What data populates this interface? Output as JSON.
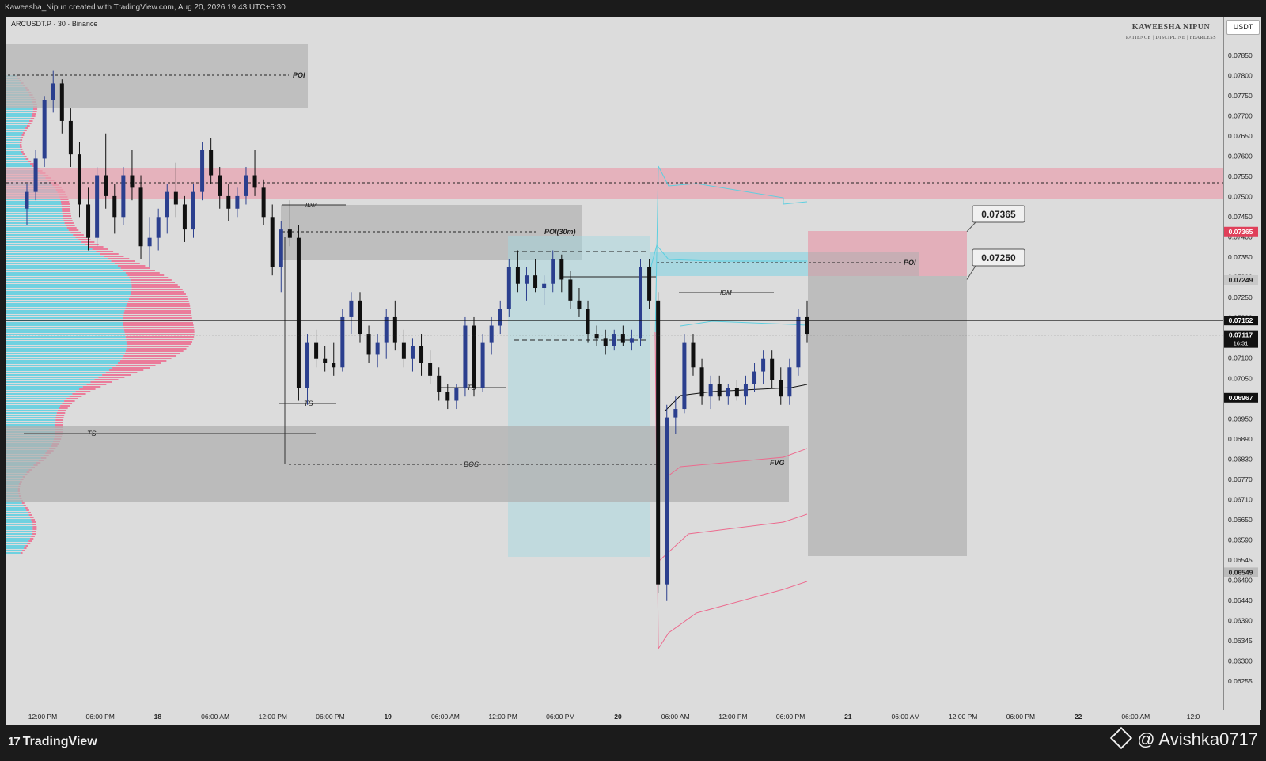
{
  "header": {
    "attribution": "Kaweesha_Nipun created with TradingView.com, Aug 20, 2026 19:43 UTC+5:30",
    "symbol": "ARCUSDT.P · 30 · Binance",
    "brand_name": "KAWEESHA NIPUN",
    "brand_tagline": "PATIENCE | DISCIPLINE | FEARLESS",
    "currency": "USDT"
  },
  "footer": {
    "logo": "TradingView",
    "watermark": "@ Avishka0717"
  },
  "colors": {
    "background": "#dcdcdc",
    "bull": "#2b3f8e",
    "bear": "#101010",
    "supply_zone": "#e8a4b2",
    "profile_blue": "#5ccfe0",
    "profile_pink": "#ec6b8e",
    "premium_zone": "#9fd6e0"
  },
  "annotations": {
    "poi_top": "POI",
    "idm_top": "IDM",
    "poi_30m": "POI(30m)",
    "ts_1": "TS",
    "ts_2": "TS",
    "ts_3": "TS",
    "bos": "BOS",
    "fvg": "FVG",
    "idm_right": "IDM",
    "poi_right": "POI",
    "target_high": "0.07365",
    "target_low": "0.07250"
  },
  "chart_data": {
    "type": "candlestick",
    "y_ticks": [
      "0.07850",
      "0.07800",
      "0.07750",
      "0.07700",
      "0.07650",
      "0.07600",
      "0.07550",
      "0.07500",
      "0.07450",
      "0.07400",
      "0.07350",
      "0.07300",
      "0.07250",
      "0.07200",
      "0.07150",
      "0.07100",
      "0.07050",
      "0.07000",
      "0.06950",
      "0.06890",
      "0.06830",
      "0.06770",
      "0.06710",
      "0.06650",
      "0.06590",
      "0.06545",
      "0.06490",
      "0.06440",
      "0.06390",
      "0.06345",
      "0.06300",
      "0.06255"
    ],
    "x_ticks": [
      "12:00 PM",
      "06:00 PM",
      "18",
      "06:00 AM",
      "12:00 PM",
      "06:00 PM",
      "19",
      "06:00 AM",
      "12:00 PM",
      "06:00 PM",
      "20",
      "06:00 AM",
      "12:00 PM",
      "06:00 PM",
      "21",
      "06:00 AM",
      "12:00 PM",
      "06:00 PM",
      "22",
      "06:00 AM",
      "12:0"
    ],
    "price_labels": [
      {
        "text": "0.07365",
        "value": 0.07365,
        "bg": "#e0405a",
        "color": "#ffffff"
      },
      {
        "text": "0.07249",
        "value": 0.07249,
        "bg": "#c8c8c8",
        "color": "#222222"
      },
      {
        "text": "0.07152",
        "value": 0.07152,
        "bg": "#111111",
        "color": "#ffffff"
      },
      {
        "text": "0.07117",
        "sub": "16:31",
        "value": 0.07117,
        "bg": "#111111",
        "color": "#ffffff"
      },
      {
        "text": "0.06967",
        "value": 0.06967,
        "bg": "#111111",
        "color": "#ffffff"
      },
      {
        "text": "0.06549",
        "value": 0.06549,
        "bg": "#bbbbbb",
        "color": "#222222"
      }
    ],
    "candles": [
      [
        0.0742,
        0.0748,
        0.0738,
        0.0746
      ],
      [
        0.0746,
        0.0756,
        0.0744,
        0.0754
      ],
      [
        0.0754,
        0.0769,
        0.0752,
        0.0768
      ],
      [
        0.0768,
        0.0775,
        0.0765,
        0.0772
      ],
      [
        0.0772,
        0.0773,
        0.076,
        0.0763
      ],
      [
        0.0763,
        0.0766,
        0.0752,
        0.0755
      ],
      [
        0.0755,
        0.0758,
        0.074,
        0.0743
      ],
      [
        0.0743,
        0.0747,
        0.0732,
        0.0735
      ],
      [
        0.0735,
        0.0752,
        0.0733,
        0.075
      ],
      [
        0.075,
        0.076,
        0.0742,
        0.0745
      ],
      [
        0.0745,
        0.0748,
        0.0736,
        0.074
      ],
      [
        0.074,
        0.0752,
        0.0738,
        0.075
      ],
      [
        0.075,
        0.0756,
        0.0744,
        0.0747
      ],
      [
        0.0747,
        0.075,
        0.073,
        0.0733
      ],
      [
        0.0733,
        0.074,
        0.0728,
        0.0735
      ],
      [
        0.0735,
        0.0742,
        0.0732,
        0.074
      ],
      [
        0.074,
        0.0748,
        0.0736,
        0.0746
      ],
      [
        0.0746,
        0.0753,
        0.074,
        0.0743
      ],
      [
        0.0743,
        0.0745,
        0.0734,
        0.0737
      ],
      [
        0.0737,
        0.0748,
        0.0735,
        0.0746
      ],
      [
        0.0746,
        0.0758,
        0.0744,
        0.0756
      ],
      [
        0.0756,
        0.0759,
        0.0748,
        0.075
      ],
      [
        0.075,
        0.0752,
        0.0742,
        0.0745
      ],
      [
        0.0745,
        0.0748,
        0.0739,
        0.0742
      ],
      [
        0.0742,
        0.0747,
        0.074,
        0.0745
      ],
      [
        0.0745,
        0.0752,
        0.0743,
        0.075
      ],
      [
        0.075,
        0.0756,
        0.0745,
        0.0747
      ],
      [
        0.0747,
        0.0749,
        0.0738,
        0.074
      ],
      [
        0.074,
        0.0743,
        0.0726,
        0.0728
      ],
      [
        0.0728,
        0.0739,
        0.0722,
        0.0737
      ],
      [
        0.0737,
        0.0744,
        0.0733,
        0.0735
      ],
      [
        0.0735,
        0.0738,
        0.0696,
        0.0699
      ],
      [
        0.0699,
        0.0712,
        0.0695,
        0.071
      ],
      [
        0.071,
        0.0713,
        0.0704,
        0.0706
      ],
      [
        0.0706,
        0.0709,
        0.0703,
        0.0705
      ],
      [
        0.0705,
        0.071,
        0.0702,
        0.0704
      ],
      [
        0.0704,
        0.0718,
        0.0703,
        0.0716
      ],
      [
        0.0716,
        0.0722,
        0.0712,
        0.072
      ],
      [
        0.072,
        0.0722,
        0.071,
        0.0712
      ],
      [
        0.0712,
        0.0714,
        0.0705,
        0.0707
      ],
      [
        0.0707,
        0.0712,
        0.0704,
        0.071
      ],
      [
        0.071,
        0.0718,
        0.0706,
        0.0716
      ],
      [
        0.0716,
        0.072,
        0.0708,
        0.071
      ],
      [
        0.071,
        0.0713,
        0.0704,
        0.0706
      ],
      [
        0.0706,
        0.0711,
        0.0703,
        0.0709
      ],
      [
        0.0709,
        0.0712,
        0.0702,
        0.0705
      ],
      [
        0.0705,
        0.0708,
        0.07,
        0.0702
      ],
      [
        0.0702,
        0.0704,
        0.0696,
        0.0698
      ],
      [
        0.0698,
        0.07,
        0.0694,
        0.0696
      ],
      [
        0.0696,
        0.07,
        0.0694,
        0.0699
      ],
      [
        0.0699,
        0.0716,
        0.0697,
        0.0714
      ],
      [
        0.0714,
        0.0716,
        0.0697,
        0.0699
      ],
      [
        0.0699,
        0.0712,
        0.0698,
        0.071
      ],
      [
        0.071,
        0.0716,
        0.0707,
        0.0714
      ],
      [
        0.0714,
        0.072,
        0.0712,
        0.0718
      ],
      [
        0.0718,
        0.073,
        0.0716,
        0.0728
      ],
      [
        0.0728,
        0.0732,
        0.0722,
        0.0724
      ],
      [
        0.0724,
        0.0728,
        0.072,
        0.0726
      ],
      [
        0.0726,
        0.073,
        0.0722,
        0.0723
      ],
      [
        0.0723,
        0.0726,
        0.0719,
        0.0724
      ],
      [
        0.0724,
        0.0732,
        0.0722,
        0.073
      ],
      [
        0.073,
        0.0731,
        0.0722,
        0.0725
      ],
      [
        0.0725,
        0.0727,
        0.0718,
        0.072
      ],
      [
        0.072,
        0.0723,
        0.0716,
        0.0718
      ],
      [
        0.0718,
        0.072,
        0.071,
        0.0712
      ],
      [
        0.0712,
        0.0714,
        0.0709,
        0.0711
      ],
      [
        0.0711,
        0.0713,
        0.0707,
        0.0709
      ],
      [
        0.0709,
        0.0713,
        0.0708,
        0.0712
      ],
      [
        0.0712,
        0.0714,
        0.0709,
        0.071
      ],
      [
        0.071,
        0.0713,
        0.0708,
        0.0711
      ],
      [
        0.0711,
        0.073,
        0.0709,
        0.0728
      ],
      [
        0.0728,
        0.073,
        0.0718,
        0.072
      ],
      [
        0.072,
        0.0722,
        0.065,
        0.0652
      ],
      [
        0.0652,
        0.0695,
        0.0648,
        0.0692
      ],
      [
        0.0692,
        0.0697,
        0.0688,
        0.0694
      ],
      [
        0.0694,
        0.0712,
        0.0693,
        0.071
      ],
      [
        0.071,
        0.0712,
        0.0702,
        0.0704
      ],
      [
        0.0704,
        0.0706,
        0.0695,
        0.0697
      ],
      [
        0.0697,
        0.0702,
        0.0694,
        0.07
      ],
      [
        0.07,
        0.0702,
        0.0696,
        0.0697
      ],
      [
        0.0697,
        0.07,
        0.0695,
        0.0699
      ],
      [
        0.0699,
        0.0701,
        0.0696,
        0.0697
      ],
      [
        0.0697,
        0.0702,
        0.0695,
        0.07
      ],
      [
        0.07,
        0.0705,
        0.0698,
        0.0703
      ],
      [
        0.0703,
        0.0708,
        0.07,
        0.0706
      ],
      [
        0.0706,
        0.0708,
        0.0699,
        0.0701
      ],
      [
        0.0701,
        0.0704,
        0.0695,
        0.0697
      ],
      [
        0.0697,
        0.0706,
        0.0695,
        0.0704
      ],
      [
        0.0704,
        0.0718,
        0.0702,
        0.0716
      ],
      [
        0.0716,
        0.072,
        0.071,
        0.0712
      ]
    ]
  }
}
